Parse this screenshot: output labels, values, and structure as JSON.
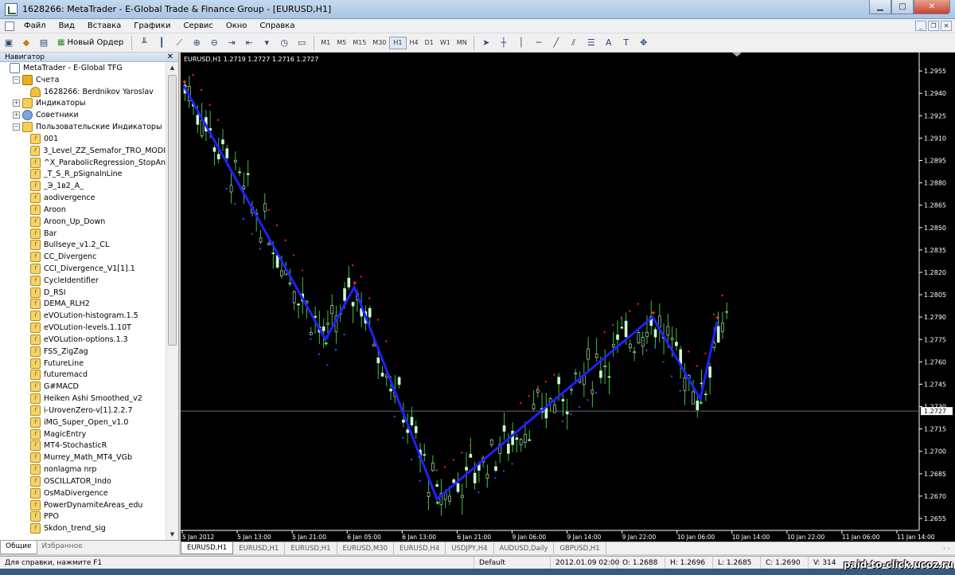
{
  "window": {
    "title": "1628266: MetaTrader - E-Global Trade & Finance Group - [EURUSD,H1]"
  },
  "menu": [
    "Файл",
    "Вид",
    "Вставка",
    "Графики",
    "Сервис",
    "Окно",
    "Справка"
  ],
  "toolbar": {
    "new_order": "Новый Ордер",
    "timeframes": [
      "M1",
      "M5",
      "M15",
      "M30",
      "H1",
      "H4",
      "D1",
      "W1",
      "MN"
    ],
    "active_timeframe": "H1"
  },
  "navigator": {
    "title": "Навигатор",
    "root": "MetaTrader - E-Global TFG",
    "accounts": "Счета",
    "account": "1628266: Berdnikov Yaroslav",
    "indicators": "Индикаторы",
    "advisors": "Советники",
    "custom": "Пользовательские Индикаторы",
    "items": [
      "001",
      "3_Level_ZZ_Semafor_TRO_MODI",
      "^X_ParabolicRegression_StopAn",
      "_T_S_R_pSignalnLine",
      "_Э_1в2_А_",
      "aodivergence",
      "Aroon",
      "Aroon_Up_Down",
      "Bar",
      "Bullseye_v1.2_CL",
      "CC_Divergenc",
      "CCI_Divergence_V1[1].1",
      "CycleIdentifier",
      "D_RSI",
      "DEMA_RLH2",
      "eVOLution-histogram.1.5",
      "eVOLution-levels.1.10T",
      "eVOLution-options.1.3",
      "FSS_ZigZag",
      "FutureLine",
      "futuremacd",
      "G#MACD",
      "Heiken Ashi Smoothed_v2",
      "i-UrovenZero-v[1].2.2.7",
      "iMG_Super_Open_v1.0",
      "MagicEntry",
      "MT4-StochasticR",
      "Murrey_Math_MT4_VGb",
      "nonlagma nrp",
      "OSCILLATOR_Indo",
      "OsMaDivergence",
      "PowerDynamiteAreas_edu",
      "PPO",
      "Skdon_trend_sig"
    ],
    "tabs": [
      "Общие",
      "Избранное"
    ]
  },
  "chart_data": {
    "type": "candlestick",
    "info": "EURUSD,H1  1.2719 1.2727 1.2716 1.2727",
    "price_levels": [
      "1.2955",
      "1.2940",
      "1.2925",
      "1.2910",
      "1.2895",
      "1.2880",
      "1.2865",
      "1.2850",
      "1.2835",
      "1.2820",
      "1.2805",
      "1.2790",
      "1.2775",
      "1.2760",
      "1.2745",
      "1.2730",
      "1.2715",
      "1.2700",
      "1.2685",
      "1.2670",
      "1.2655"
    ],
    "ylim": [
      1.2647,
      1.2962
    ],
    "current_price": "1.2727",
    "current_value": 1.2727,
    "time_labels": [
      "5 Jan 2012",
      "5 Jan 13:00",
      "5 Jan 21:00",
      "6 Jan 05:00",
      "6 Jan 13:00",
      "6 Jan 21:00",
      "9 Jan 06:00",
      "9 Jan 14:00",
      "9 Jan 22:00",
      "10 Jan 06:00",
      "10 Jan 14:00",
      "10 Jan 22:00",
      "11 Jan 06:00",
      "11 Jan 14:00"
    ],
    "zigzag": [
      1.2945,
      1.2775,
      1.281,
      1.2668,
      1.279,
      1.2735,
      1.2787
    ],
    "candle_color": "#ccffcc",
    "zigzag_color": "#2020ff",
    "sar_color": "#ff2020"
  },
  "chart_tabs": [
    "EURUSD,H1",
    "EURUSD,H1",
    "EURUSD,H1",
    "EURUSD,M30",
    "EURUSD,H4",
    "USDJPY,H4",
    "AUDUSD,Daily",
    "GBPUSD,H1"
  ],
  "status": {
    "help": "Для справки, нажмите F1",
    "profile": "Default",
    "time": "2012.01.09 02:00",
    "open": "O: 1.2688",
    "high": "H: 1.2696",
    "low": "L: 1.2685",
    "close": "C: 1.2690",
    "volume": "V: 314"
  },
  "watermark": "paid-to-click.ucoz.ru"
}
